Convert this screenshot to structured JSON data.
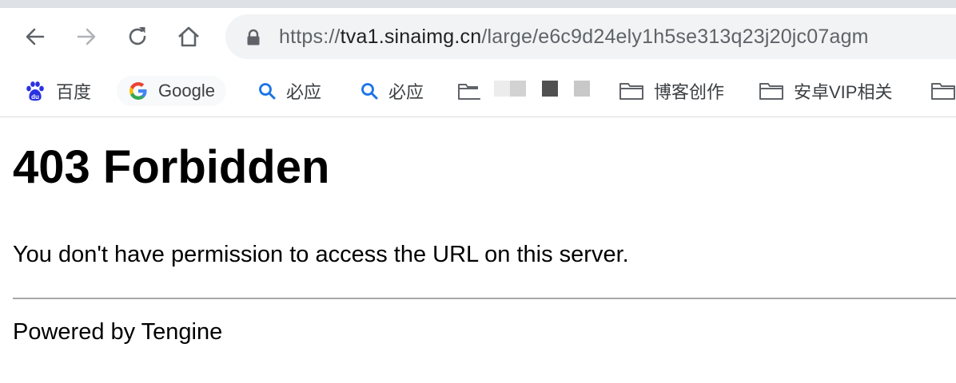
{
  "browser": {
    "address_bar": {
      "scheme": "https://",
      "host": "tva1.sinaimg.cn",
      "path": "/large/e6c9d24ely1h5se313q23j20jc07agm"
    },
    "nav_icons": [
      "back-arrow-icon",
      "forward-arrow-icon",
      "reload-icon",
      "home-icon"
    ]
  },
  "bookmarks": {
    "items": [
      {
        "label": "百度",
        "icon": "baidu-paw-icon"
      },
      {
        "label": "Google",
        "icon": "google-g-icon"
      },
      {
        "label": "必应",
        "icon": "search-icon"
      },
      {
        "label": "必应",
        "icon": "search-icon"
      },
      {
        "label": "",
        "icon": "folder-icon"
      },
      {
        "label": "博客创作",
        "icon": "folder-icon"
      },
      {
        "label": "安卓VIP相关",
        "icon": "folder-icon"
      }
    ]
  },
  "page": {
    "heading": "403 Forbidden",
    "message": "You don't have permission to access the URL on this server.",
    "footer": "Powered by Tengine"
  },
  "colors": {
    "accent_blue": "#1a73e8",
    "omnibox_bg": "#f1f3f4",
    "icon_gray": "#5f6368"
  }
}
